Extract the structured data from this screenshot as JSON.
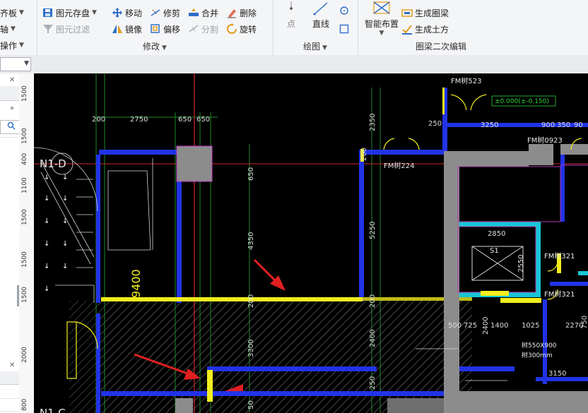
{
  "ribbon": {
    "left_group": {
      "align_label": "齐板",
      "axis_label": "轴",
      "ops_label": "操作"
    },
    "edit_group": {
      "name": "修改",
      "element_save": "图元存盘",
      "element_filter": "图元过滤",
      "move": "移动",
      "trim": "修剪",
      "merge": "合并",
      "delete": "删除",
      "mirror": "镜像",
      "offset": "偏移",
      "split": "分割",
      "rotate": "旋转"
    },
    "draw_group": {
      "name": "绘图",
      "point": "点",
      "line": "直线"
    },
    "ring_beam_group": {
      "name": "圈梁二次编辑",
      "smart_layout": "智能布置",
      "gen_ring_beam": "生成圈梁",
      "gen_earthwork": "生成土方"
    }
  },
  "ruler": {
    "values": [
      "1500",
      "1500",
      "400",
      "1100",
      "1500",
      "1500",
      "1500",
      "2000",
      "800"
    ]
  },
  "drawing": {
    "axis_label": "N1-D",
    "axis_label_2": "N1-C",
    "dims_top": [
      "200",
      "2750",
      "650",
      "650"
    ],
    "dim_2350": "2350",
    "dim_250": "250",
    "dim_3250": "3250",
    "dim_900": "900",
    "dim_350": "350",
    "dim_90": "90",
    "dim_650v": "650",
    "dim_4350": "4350",
    "dim_5250": "5250",
    "dim_9400": "9400",
    "dim_3300": "3300",
    "dim_2400": "2400",
    "dim_2850": "2850",
    "dim_2550": "2550",
    "dim_200a": "200",
    "dim_200b": "200",
    "dim_200c": "200",
    "dims_bottom_right": [
      "500",
      "725",
      "1400",
      "1025",
      "2270",
      "750"
    ],
    "dim_3150": "3150",
    "dim_250b": "250",
    "dim_50": "50",
    "dim_2400b": "2400",
    "door_fm523": "FM树523",
    "door_fm1224": "FM树224",
    "door_fm0923": "FM树0923",
    "door_fm321a": "FM树321",
    "door_fm321b": "FM树321",
    "elevation": "±0.000(±-0.150)",
    "label_s1": "S1",
    "beam_550": "树550X900",
    "beam_300": "树300mm"
  }
}
